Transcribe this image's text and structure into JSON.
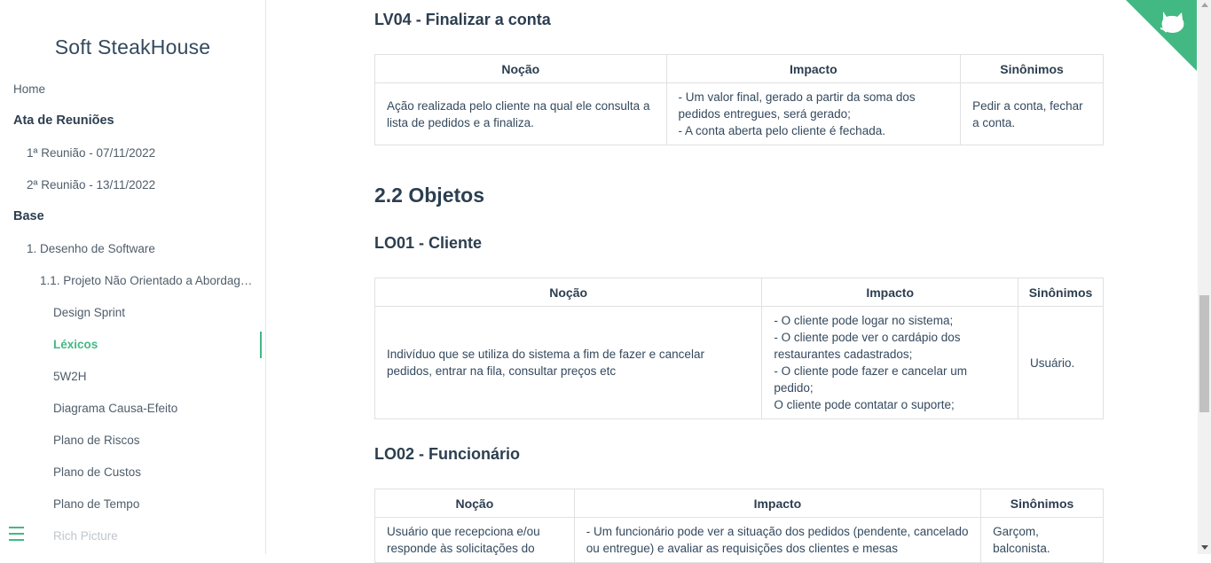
{
  "colors": {
    "accent": "#42b983",
    "text": "#34495e",
    "border": "#e1e1e1"
  },
  "sidebar": {
    "app_name": "Soft SteakHouse",
    "items": [
      {
        "label": "Home"
      },
      {
        "label": "Ata de Reuniões"
      },
      {
        "label": "1ª Reunião - 07/11/2022"
      },
      {
        "label": "2ª Reunião - 13/11/2022"
      },
      {
        "label": "Base"
      },
      {
        "label": "1. Desenho de Software"
      },
      {
        "label": "1.1. Projeto Não Orientado a Abordagen..."
      },
      {
        "label": "Design Sprint"
      },
      {
        "label": "Léxicos"
      },
      {
        "label": "5W2H"
      },
      {
        "label": "Diagrama Causa-Efeito"
      },
      {
        "label": "Plano de Riscos"
      },
      {
        "label": "Plano de Custos"
      },
      {
        "label": "Plano de Tempo"
      },
      {
        "label": "Rich Picture"
      }
    ],
    "menu_icon": "hamburger-icon"
  },
  "content": {
    "lv04": {
      "title": "LV04 - Finalizar a conta",
      "headers": [
        "Noção",
        "Impacto",
        "Sinônimos"
      ],
      "row": {
        "nocao": "Ação realizada pelo cliente na qual ele consulta a lista de pedidos e a finaliza.",
        "impacto_1": "- Um valor final, gerado a partir da soma dos pedidos entregues, será gerado;",
        "impacto_2": "- A conta aberta pelo cliente é fechada.",
        "sinonimos": "Pedir a conta, fechar a conta."
      }
    },
    "objetos_title": "2.2 Objetos",
    "lo01": {
      "title": "LO01 - Cliente",
      "headers": [
        "Noção",
        "Impacto",
        "Sinônimos"
      ],
      "row": {
        "nocao": "Indivíduo que se utiliza do sistema a fim de fazer e cancelar pedidos, entrar na fila, consultar preços etc",
        "impacto_1": "- O cliente pode logar no sistema;",
        "impacto_2": "- O cliente pode ver o cardápio dos restaurantes cadastrados;",
        "impacto_3": "- O cliente pode fazer e cancelar um pedido;",
        "impacto_4": "O cliente pode contatar o suporte;",
        "sinonimos": "Usuário."
      }
    },
    "lo02": {
      "title": "LO02 - Funcionário",
      "headers": [
        "Noção",
        "Impacto",
        "Sinônimos"
      ],
      "row": {
        "nocao": "Usuário que recepciona e/ou responde às solicitações do",
        "impacto": "- Um funcionário pode ver a situação dos pedidos (pendente, cancelado ou entregue) e avaliar as requisições dos clientes e mesas",
        "sinonimos": "Garçom, balconista."
      }
    }
  },
  "corner_icon": "github-octocat-icon"
}
